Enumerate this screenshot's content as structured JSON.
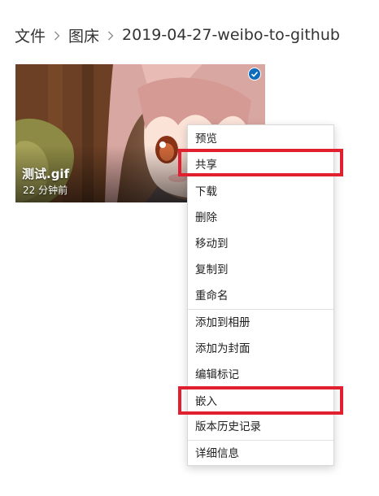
{
  "breadcrumb": {
    "items": [
      "文件",
      "图床",
      "2019-04-27-weibo-to-github"
    ],
    "separator_icon": "chevron-right-icon"
  },
  "tile": {
    "file_name": "测试.gif",
    "modified": "22 分钟前",
    "selected": true,
    "selection_icon": "checkmark-circle-icon"
  },
  "context_menu": {
    "items": [
      {
        "label": "预览"
      },
      {
        "label": "共享"
      },
      {
        "label": "下载"
      },
      {
        "label": "删除"
      },
      {
        "label": "移动到"
      },
      {
        "label": "复制到"
      },
      {
        "label": "重命名"
      },
      {
        "label": "添加到相册"
      },
      {
        "label": "添加为封面"
      },
      {
        "label": "编辑标记"
      },
      {
        "label": "嵌入"
      },
      {
        "label": "版本历史记录"
      },
      {
        "label": "详细信息"
      }
    ],
    "highlighted": [
      "共享",
      "嵌入"
    ]
  },
  "colors": {
    "accent": "#0f6cbd",
    "highlight": "#e0202e",
    "text": "#1f1f1f"
  }
}
